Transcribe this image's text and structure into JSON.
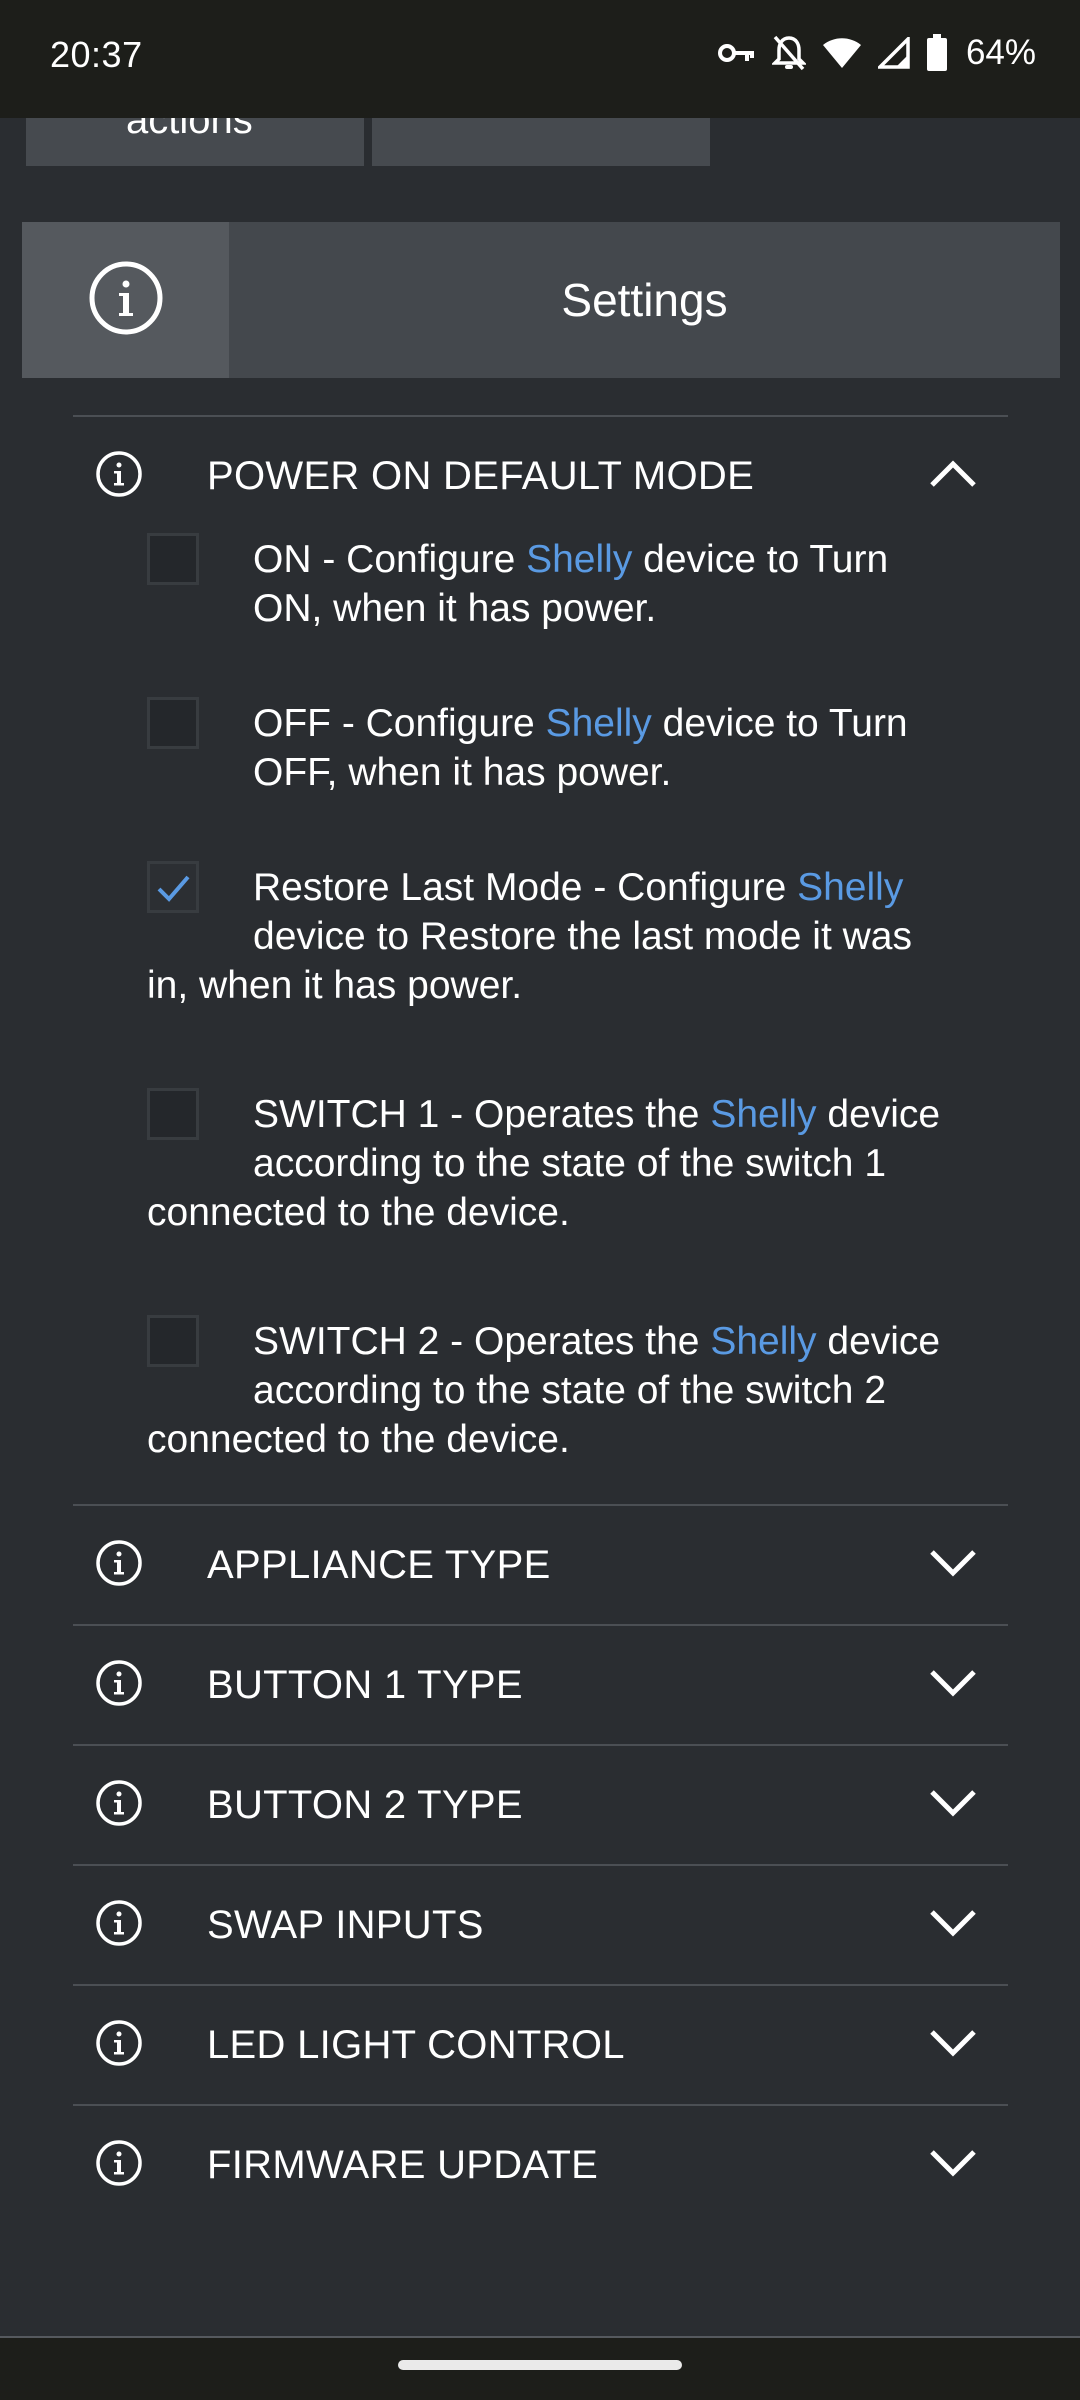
{
  "status_bar": {
    "time": "20:37",
    "battery": "64%",
    "icons": [
      "vpn-key-icon",
      "notifications-off-icon",
      "wifi-icon",
      "signal-icon",
      "battery-icon"
    ]
  },
  "top_tabs": {
    "left_label": "actions",
    "right_label": ""
  },
  "header": {
    "title": "Settings",
    "icon": "info-icon"
  },
  "sections": {
    "power_on": {
      "title": "POWER ON DEFAULT MODE",
      "expanded": true,
      "options": [
        {
          "pre": "ON - Configure ",
          "link": "Shelly",
          "post": " device to Turn ON, when it has power.",
          "checked": false
        },
        {
          "pre": "OFF - Configure ",
          "link": "Shelly",
          "post": " device to Turn OFF, when it has power.",
          "checked": false
        },
        {
          "pre": "Restore Last Mode - Configure ",
          "link": "Shelly",
          "post": " device to Restore the last mode it was in, when it has power.",
          "checked": true
        },
        {
          "pre": "SWITCH 1 - Operates the ",
          "link": "Shelly",
          "post": " device according to the state of the switch 1 connected to the device.",
          "checked": false
        },
        {
          "pre": "SWITCH 2 - Operates the ",
          "link": "Shelly",
          "post": " device according to the state of the switch 2 connected to the device.",
          "checked": false
        }
      ]
    },
    "appliance_type": {
      "title": "APPLIANCE TYPE"
    },
    "button1_type": {
      "title": "BUTTON 1 TYPE"
    },
    "button2_type": {
      "title": "BUTTON 2 TYPE"
    },
    "swap_inputs": {
      "title": "SWAP INPUTS"
    },
    "led_light": {
      "title": "LED LIGHT CONTROL"
    },
    "firmware": {
      "title": "FIRMWARE UPDATE"
    }
  },
  "colors": {
    "background": "#2a2d31",
    "header": "#44484d",
    "link": "#5a9ae3"
  }
}
